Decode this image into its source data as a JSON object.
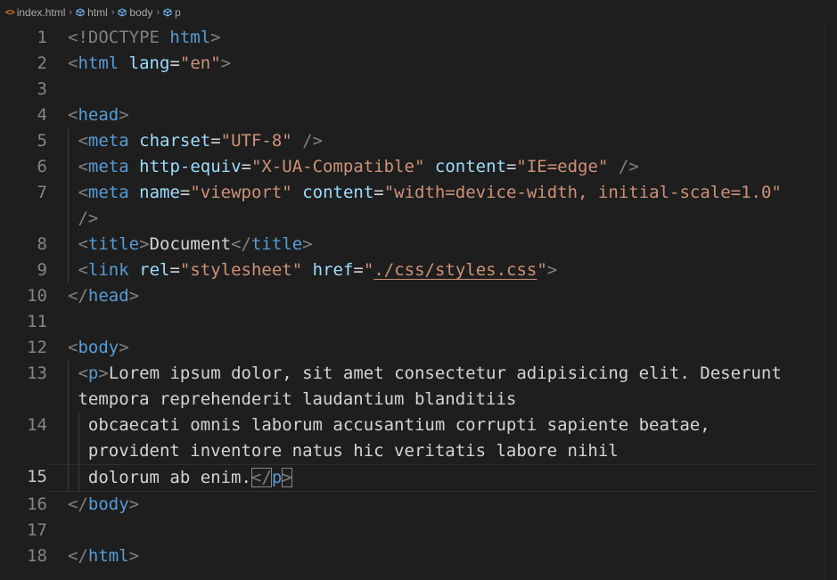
{
  "breadcrumb": {
    "file": "index.html",
    "items": [
      "html",
      "body",
      "p"
    ]
  },
  "colors": {
    "background": "#1e1e1e",
    "tag": "#569cd6",
    "attribute": "#9cdcfe",
    "string": "#ce9178",
    "bracket": "#808080",
    "text": "#d4d4d4"
  },
  "line_numbers": [
    "1",
    "2",
    "3",
    "4",
    "5",
    "6",
    "7",
    "8",
    "9",
    "10",
    "11",
    "12",
    "13",
    "14",
    "15",
    "16",
    "17",
    "18"
  ],
  "current_line": "15",
  "tokens": {
    "l1": [
      "<!DOCTYPE",
      "html",
      ">"
    ],
    "l2": [
      "<",
      "html",
      "lang",
      "=",
      "\"en\"",
      ">"
    ],
    "l4": [
      "<",
      "head",
      ">"
    ],
    "l5": [
      "<",
      "meta",
      "charset",
      "=",
      "\"UTF-8\"",
      "/>"
    ],
    "l6": [
      "<",
      "meta",
      "http-equiv",
      "=",
      "\"X-UA-Compatible\"",
      "content",
      "=",
      "\"IE=edge\"",
      "/>"
    ],
    "l7a": [
      "<",
      "meta",
      "name",
      "=",
      "\"viewport\"",
      "content",
      "=",
      "\"width=device-width, initial-scale=1.0\""
    ],
    "l7b": [
      "/>"
    ],
    "l8": [
      "<",
      "title",
      ">",
      "Document",
      "</",
      "title",
      ">"
    ],
    "l9": [
      "<",
      "link",
      "rel",
      "=",
      "\"stylesheet\"",
      "href",
      "=",
      "\"",
      "./css/styles.css",
      "\"",
      ">"
    ],
    "l10": [
      "</",
      "head",
      ">"
    ],
    "l12": [
      "<",
      "body",
      ">"
    ],
    "l13a": [
      "<",
      "p",
      ">",
      "Lorem ipsum dolor, sit amet consectetur adipisicing elit. Deserunt"
    ],
    "l13b": [
      "tempora reprehenderit laudantium blanditiis"
    ],
    "l14a": [
      "obcaecati omnis laborum accusantium corrupti sapiente beatae,"
    ],
    "l14b": [
      "provident inventore natus hic veritatis labore nihil"
    ],
    "l15": [
      "dolorum ab enim.",
      "</",
      "p",
      ">"
    ],
    "l16": [
      "</",
      "body",
      ">"
    ],
    "l18": [
      "</",
      "html",
      ">"
    ]
  }
}
